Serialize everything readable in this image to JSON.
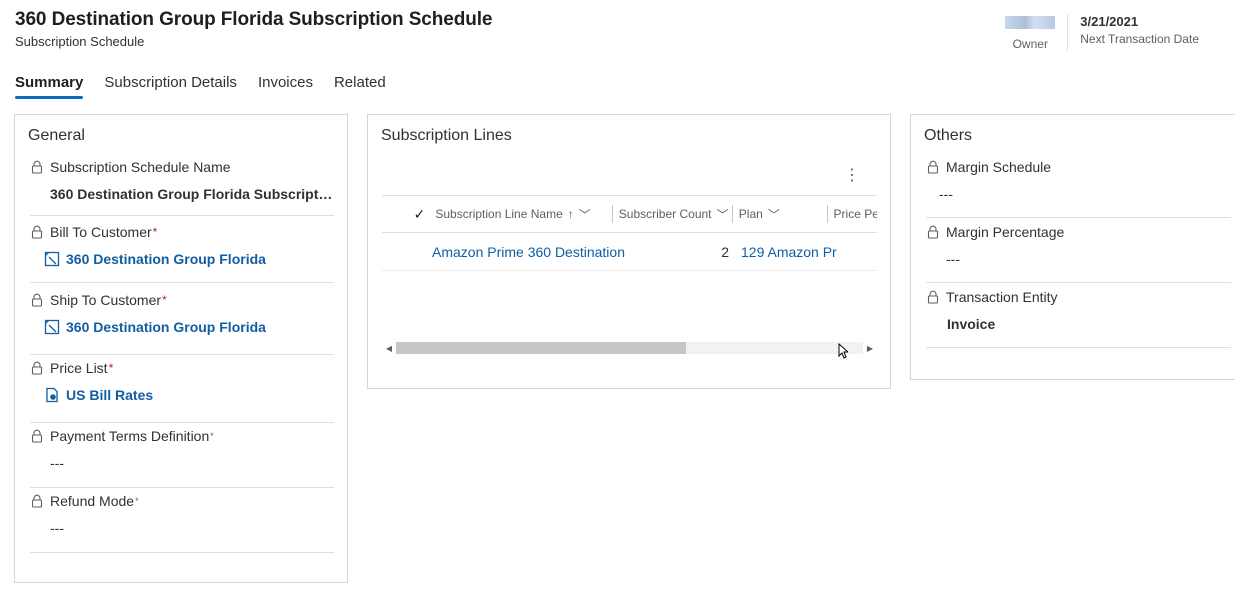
{
  "record": {
    "title": "360 Destination Group Florida Subscription Schedule",
    "entity": "Subscription Schedule"
  },
  "header_fields": {
    "owner_label": "Owner",
    "date_value": "3/21/2021",
    "date_label": "Next Transaction Date"
  },
  "tabs": [
    {
      "label": "Summary",
      "active": true
    },
    {
      "label": "Subscription Details",
      "active": false
    },
    {
      "label": "Invoices",
      "active": false
    },
    {
      "label": "Related",
      "active": false
    }
  ],
  "general": {
    "title": "General",
    "fields": [
      {
        "label": "Subscription Schedule Name",
        "required": "",
        "value": "360 Destination Group Florida Subscription ..."
      },
      {
        "label": "Bill To Customer",
        "required": "*",
        "value": "360 Destination Group Florida"
      },
      {
        "label": "Ship To Customer",
        "required": "*",
        "value": "360 Destination Group Florida"
      },
      {
        "label": "Price List",
        "required": "*",
        "value": "US Bill Rates"
      },
      {
        "label": "Payment Terms Definition",
        "required": "*",
        "value": "---"
      },
      {
        "label": "Refund Mode",
        "required": "*",
        "value": "---"
      }
    ]
  },
  "subscription_lines": {
    "title": "Subscription Lines",
    "more_icon": "more-vertical-icon",
    "columns": [
      "Subscription Line Name",
      "Subscriber Count",
      "Plan",
      "Price Pe"
    ],
    "rows": [
      {
        "name": "Amazon Prime 360 Destination",
        "count": "2",
        "plan": "129 Amazon Pr"
      }
    ],
    "scroll_fraction": 0.62
  },
  "others": {
    "title": "Others",
    "fields": [
      {
        "label": "Margin Schedule",
        "value": "---"
      },
      {
        "label": "Margin Percentage",
        "value": "---"
      },
      {
        "label": "Transaction Entity",
        "value": "Invoice"
      }
    ]
  },
  "colors": {
    "link": "#115ea3",
    "accent": "#0f6cbd",
    "required": "#a4262c"
  }
}
